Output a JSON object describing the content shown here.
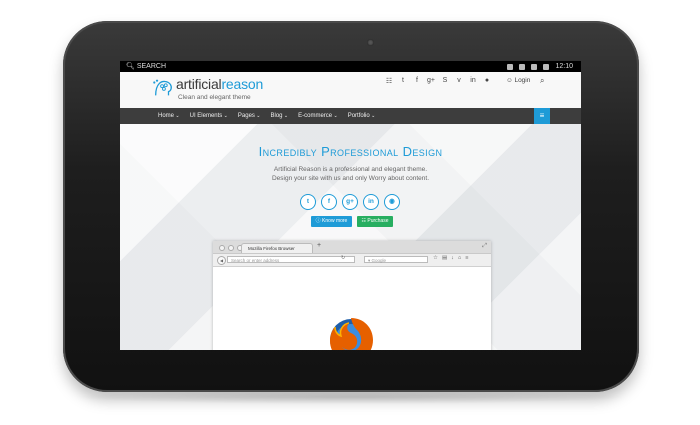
{
  "statusbar": {
    "search_label": "SEARCH",
    "time": "12:10"
  },
  "site": {
    "brand_part1": "artificial",
    "brand_part2": "reason",
    "tagline": "Clean and elegant theme"
  },
  "header": {
    "social_icons": [
      "rss-icon",
      "twitter-icon",
      "facebook-icon",
      "google-plus-icon",
      "skype-icon",
      "vimeo-icon",
      "linkedin-icon",
      "flickr-icon"
    ],
    "login_label": "Login"
  },
  "nav": {
    "items": [
      "Home",
      "UI Elements",
      "Pages",
      "Blog",
      "E-commerce",
      "Portfolio"
    ]
  },
  "hero": {
    "title": "Incredibly Professional Design",
    "subtitle_line1": "Artificial Reason is a professional and elegant theme.",
    "subtitle_line2": "Design your site with us and only Worry about content.",
    "social_icons": [
      "twitter-icon",
      "facebook-icon",
      "google-plus-icon",
      "linkedin-icon",
      "github-icon"
    ],
    "know_more_label": "Know more",
    "purchase_label": "Purchase"
  },
  "browser": {
    "tab_title": "Mozilla Firefox Browser",
    "url_placeholder": "Search or enter address",
    "search_placeholder": "Google"
  },
  "colors": {
    "accent": "#1e9bd7",
    "purchase": "#27ae60",
    "nav_bg": "#3d3d3d",
    "firefox_orange": "#e66000"
  }
}
